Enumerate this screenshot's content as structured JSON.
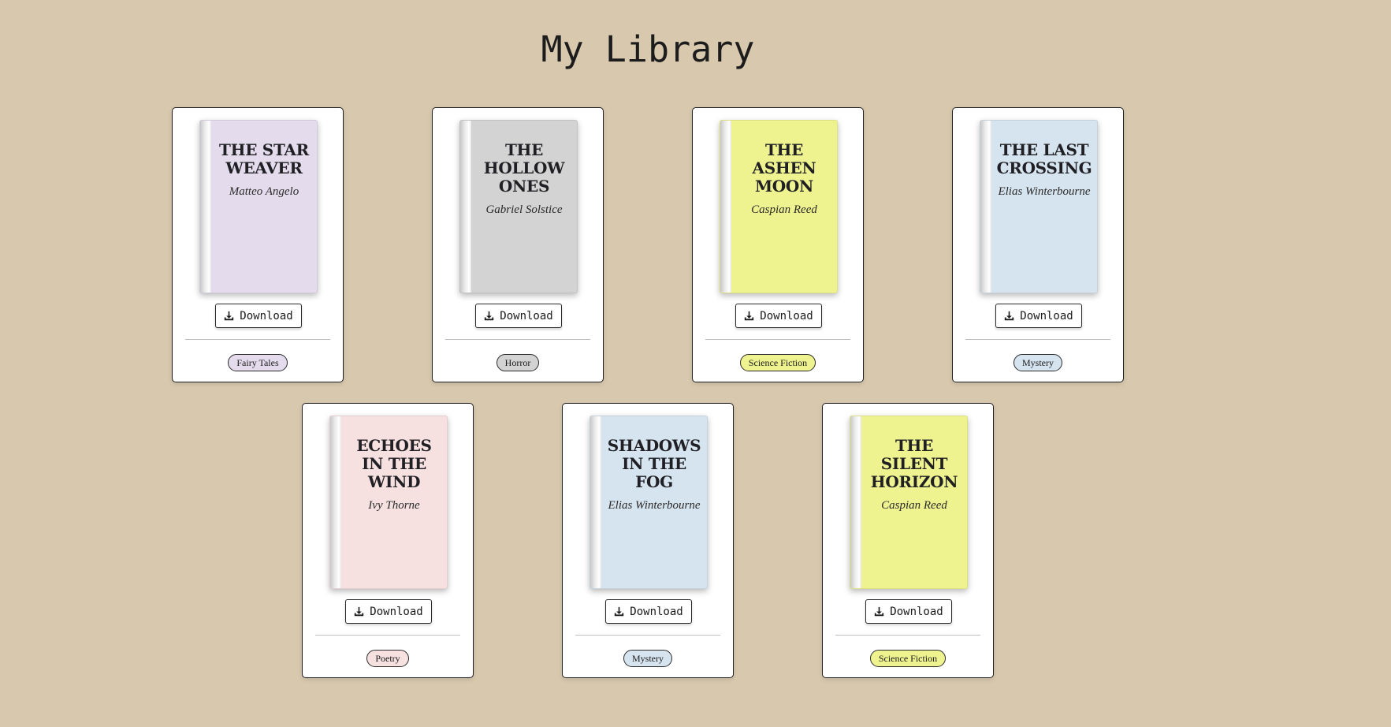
{
  "page": {
    "title": "My Library",
    "background": "#d8c8ae"
  },
  "download_icon": "download-icon",
  "books": [
    {
      "title": "The Star Weaver",
      "author": "Matteo Angelo",
      "genre": "Fairy Tales",
      "cover_color": "#e4dced",
      "download_label": "Download"
    },
    {
      "title": "The Hollow Ones",
      "author": "Gabriel Solstice",
      "genre": "Horror",
      "cover_color": "#d3d3d3",
      "download_label": "Download"
    },
    {
      "title": "The Ashen Moon",
      "author": "Caspian Reed",
      "genre": "Science Fiction",
      "cover_color": "#eff38f",
      "download_label": "Download"
    },
    {
      "title": "The Last Crossing",
      "author": "Elias Winterbourne",
      "genre": "Mystery",
      "cover_color": "#d6e4ef",
      "download_label": "Download"
    },
    {
      "title": "Echoes in the Wind",
      "author": "Ivy Thorne",
      "genre": "Poetry",
      "cover_color": "#f6e0e0",
      "download_label": "Download"
    },
    {
      "title": "Shadows in the Fog",
      "author": "Elias Winterbourne",
      "genre": "Mystery",
      "cover_color": "#d6e4ef",
      "download_label": "Download"
    },
    {
      "title": "The Silent Horizon",
      "author": "Caspian Reed",
      "genre": "Science Fiction",
      "cover_color": "#eff38f",
      "download_label": "Download"
    }
  ]
}
